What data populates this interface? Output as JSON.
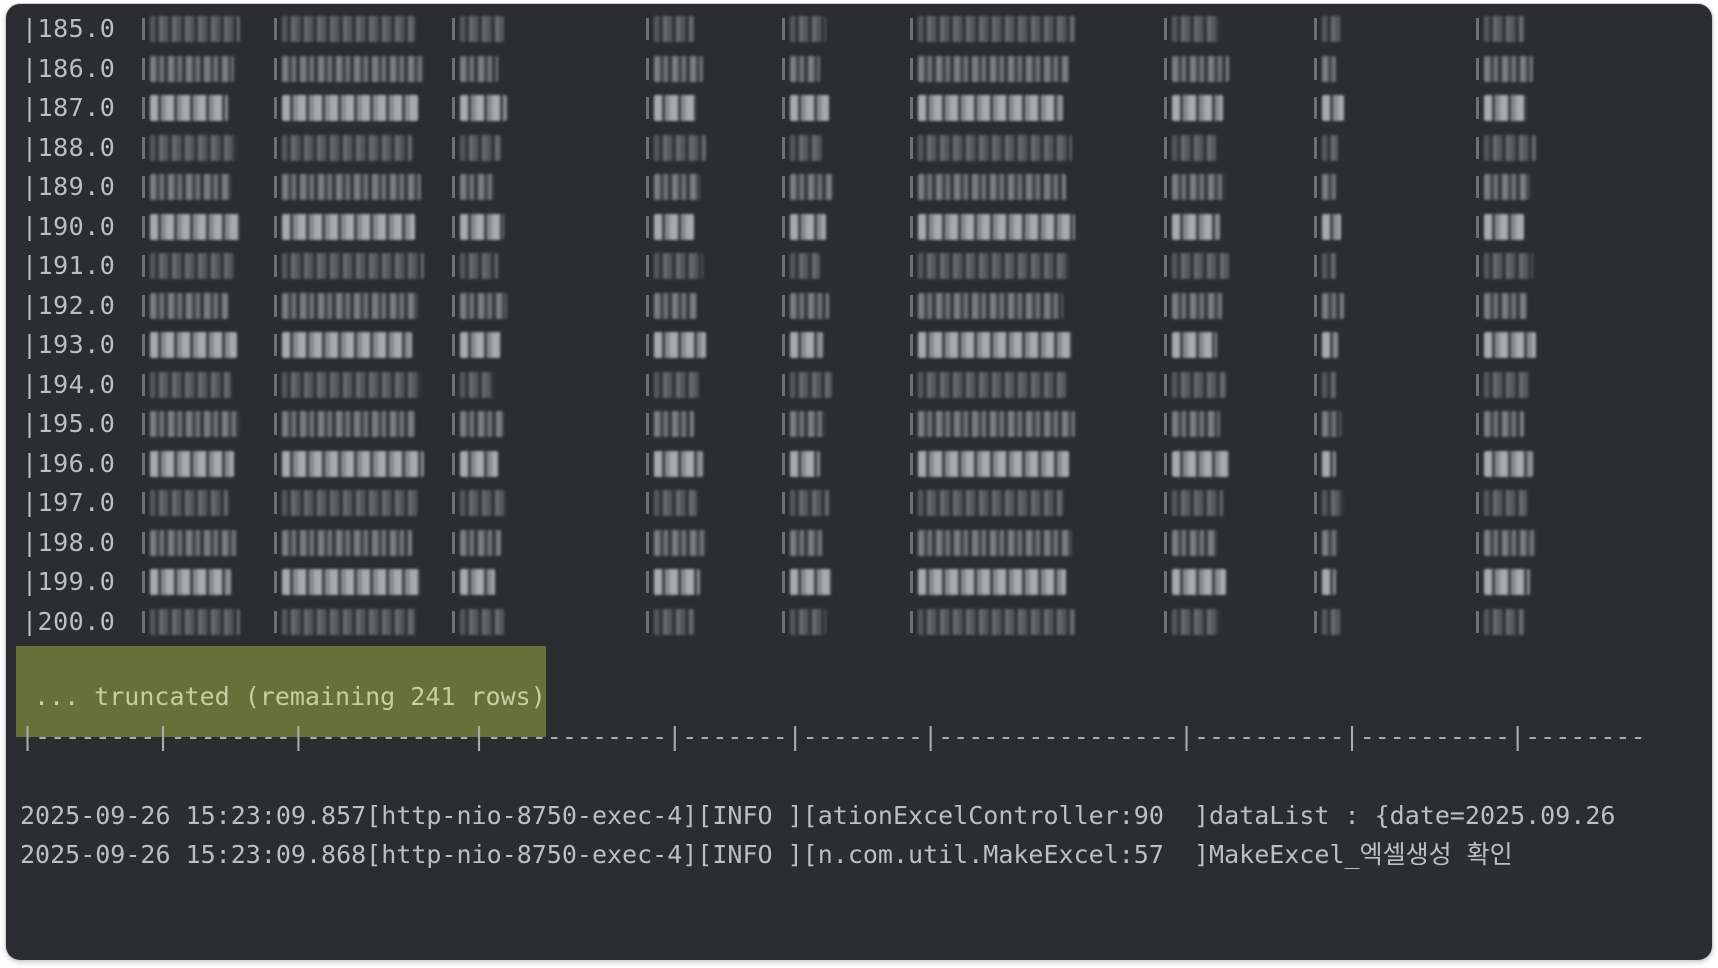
{
  "console": {
    "rows": [
      "|185.0",
      "|186.0",
      "|187.0",
      "|188.0",
      "|189.0",
      "|190.0",
      "|191.0",
      "|192.0",
      "|193.0",
      "|194.0",
      "|195.0",
      "|196.0",
      "|197.0",
      "|198.0",
      "|199.0",
      "|200.0"
    ],
    "truncated_notice": "... truncated (remaining 241 rows)",
    "divider": "|--------|--------|-----------|------------|-------|--------|----------------|----------|----------|--------",
    "log_lines": [
      "2025-09-26 15:23:09.857[http-nio-8750-exec-4][INFO ][ationExcelController:90  ]dataList : {date=2025.09.26",
      "2025-09-26 15:23:09.868[http-nio-8750-exec-4][INFO ][n.com.util.MakeExcel:57  ]MakeExcel_엑셀생성 확인"
    ]
  },
  "colors": {
    "background": "#2b2d30",
    "text": "#bcbec4",
    "highlight": "#68703a",
    "highlight_text": "#c9cca0"
  }
}
